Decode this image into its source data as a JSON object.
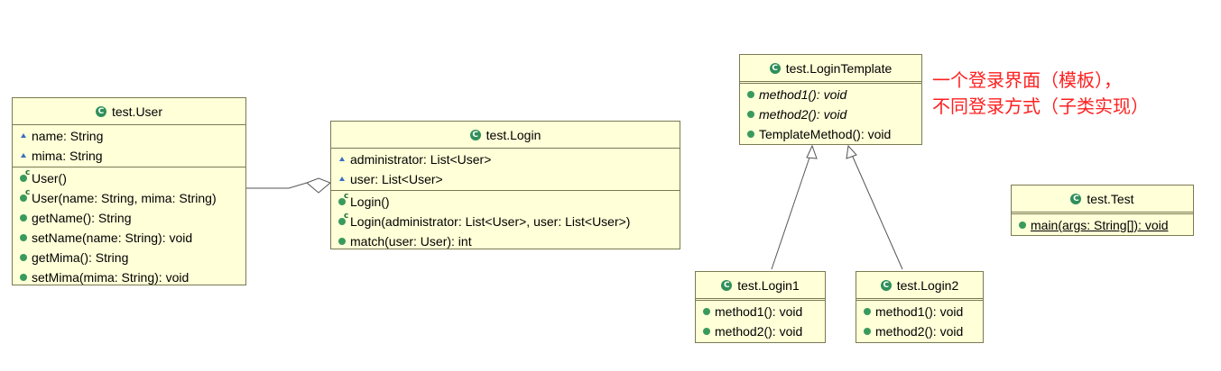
{
  "classes": {
    "user": {
      "name": "test.User",
      "attributes": [
        "name: String",
        "mima: String"
      ],
      "methods": [
        "User()",
        "User(name: String, mima: String)",
        "getName(): String",
        "setName(name: String): void",
        "getMima(): String",
        "setMima(mima: String): void"
      ]
    },
    "login": {
      "name": "test.Login",
      "attributes": [
        "administrator: List<User>",
        "user: List<User>"
      ],
      "methods": [
        "Login()",
        "Login(administrator: List<User>, user: List<User>)",
        "match(user: User): int"
      ]
    },
    "login_template": {
      "name": "test.LoginTemplate",
      "methods": [
        "method1(): void",
        "method2(): void",
        "TemplateMethod(): void"
      ]
    },
    "login1": {
      "name": "test.Login1",
      "methods": [
        "method1(): void",
        "method2(): void"
      ]
    },
    "login2": {
      "name": "test.Login2",
      "methods": [
        "method1(): void",
        "method2(): void"
      ]
    },
    "test": {
      "name": "test.Test",
      "methods": [
        "main(args: String[]): void"
      ]
    }
  },
  "note": {
    "line1": "一个登录界面（模板），",
    "line2": "不同登录方式（子类实现）",
    "color": "#ff2020"
  },
  "colors": {
    "class_fill": "#ffffd8",
    "class_border": "#7a7a52",
    "class_icon": "#2f8f5a",
    "public_marker": "#3a9a5e",
    "package_marker": "#3a6fc2"
  }
}
